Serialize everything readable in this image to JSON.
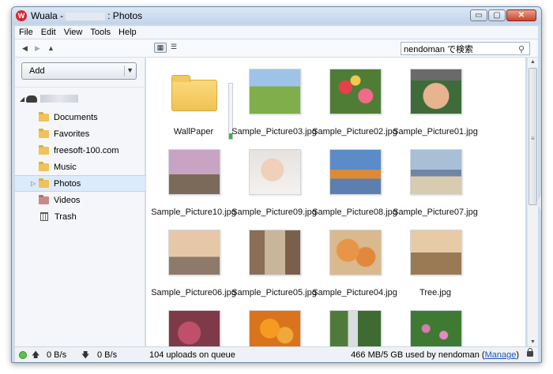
{
  "window": {
    "app_name": "Wuala -",
    "title_suffix": ": Photos",
    "controls": [
      "minimize-icon",
      "maximize-icon",
      "close-icon"
    ],
    "close_glyph": "✕",
    "minimize_glyph": "▭",
    "maximize_glyph": "▢"
  },
  "menu": [
    "File",
    "Edit",
    "View",
    "Tools",
    "Help"
  ],
  "toolbar": {
    "search_value": "nendoman で検索",
    "back_glyph": "◀",
    "forward_glyph": "▶",
    "up_glyph": "▲",
    "grid_glyph": "▦",
    "list_glyph": "☰"
  },
  "sidebar": {
    "add_label": "Add",
    "items": [
      {
        "label": "Documents",
        "icon": "folder-icon"
      },
      {
        "label": "Favorites",
        "icon": "folder-icon"
      },
      {
        "label": "freesoft-100.com",
        "icon": "folder-icon"
      },
      {
        "label": "Music",
        "icon": "folder-icon"
      },
      {
        "label": "Photos",
        "icon": "folder-icon",
        "selected": true
      },
      {
        "label": "Videos",
        "icon": "video-folder-icon"
      },
      {
        "label": "Trash",
        "icon": "trash-icon"
      }
    ]
  },
  "files": [
    {
      "name": "WallPaper",
      "type": "folder",
      "upload_progress": 0.1
    },
    {
      "name": "Sample_Picture03.jpg",
      "type": "image"
    },
    {
      "name": "Sample_Picture02.jpg",
      "type": "image"
    },
    {
      "name": "Sample_Picture01.jpg",
      "type": "image"
    },
    {
      "name": "Sample_Picture10.jpg",
      "type": "image"
    },
    {
      "name": "Sample_Picture09.jpg",
      "type": "image"
    },
    {
      "name": "Sample_Picture08.jpg",
      "type": "image"
    },
    {
      "name": "Sample_Picture07.jpg",
      "type": "image"
    },
    {
      "name": "Sample_Picture06.jpg",
      "type": "image"
    },
    {
      "name": "Sample_Picture05.jpg",
      "type": "image"
    },
    {
      "name": "Sample_Picture04.jpg",
      "type": "image"
    },
    {
      "name": "Tree.jpg",
      "type": "image"
    },
    {
      "name": "",
      "type": "image"
    },
    {
      "name": "",
      "type": "image"
    },
    {
      "name": "",
      "type": "image"
    },
    {
      "name": "",
      "type": "image"
    }
  ],
  "status": {
    "upload_rate": "0 B/s",
    "download_rate": "0 B/s",
    "queue": "104 uploads on queue",
    "usage_prefix": "466 MB/5 GB used by nendoman (",
    "manage": "Manage",
    "usage_suffix": ")",
    "up_glyph": "🡅",
    "down_glyph": "🡇"
  },
  "scrollbar": {
    "up_glyph": "▲",
    "down_glyph": "▼",
    "grip_glyph": "≡"
  }
}
